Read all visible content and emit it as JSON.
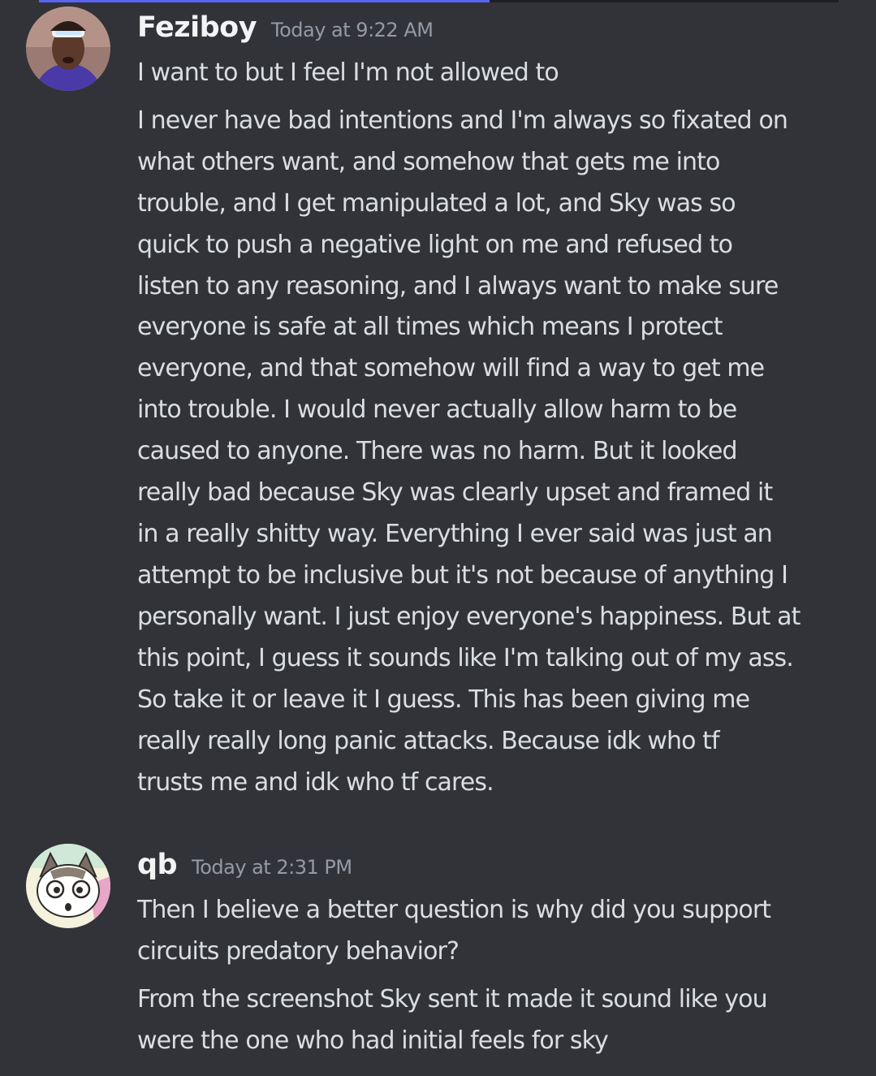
{
  "messages": [
    {
      "author": "Feziboy",
      "timestamp": "Today at 9:22 AM",
      "paragraphs": [
        [
          "I want to but I feel I'm not allowed to"
        ],
        [
          "I never have bad intentions and I'm always so fixated on",
          "what others want, and somehow that gets me into",
          "trouble, and I get manipulated a lot, and Sky was so",
          "quick to push a negative light on me and refused to",
          "listen to any reasoning, and I always want to make sure",
          "everyone is safe at all times which means I protect",
          "everyone, and that somehow will find a way to get me",
          "into trouble. I would never actually allow harm to be",
          "caused to anyone. There was no harm. But it looked",
          "really bad because Sky was clearly upset and framed it",
          "in a really shitty way. Everything I ever said was just an",
          "attempt to be inclusive but it's not because of anything I",
          "personally want. I just enjoy everyone's happiness. But at",
          "this point, I guess it sounds like I'm talking out of my ass.",
          "So take it or leave it I guess. This has been giving me",
          "really really long panic attacks. Because idk who tf",
          "trusts me and idk who tf cares."
        ]
      ]
    },
    {
      "author": "qb",
      "timestamp": "Today at 2:31 PM",
      "paragraphs": [
        [
          "Then I believe a better question is why did you support",
          "circuits predatory behavior?"
        ],
        [
          "From the screenshot Sky sent it made it sound like you",
          "were the one who had initial feels for sky"
        ]
      ]
    }
  ]
}
